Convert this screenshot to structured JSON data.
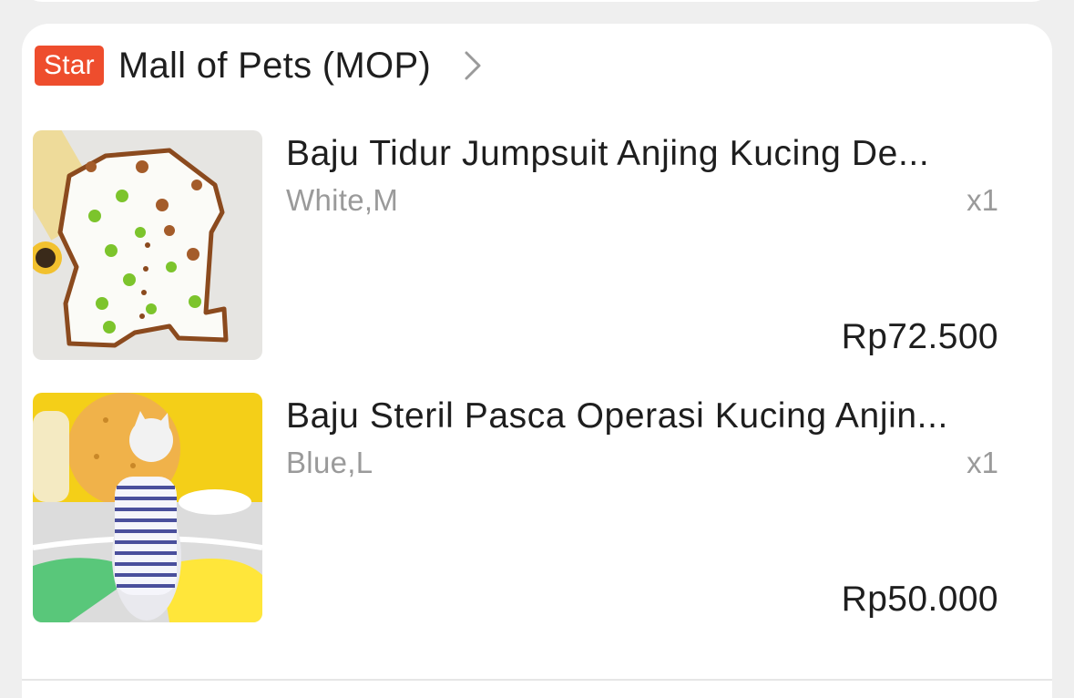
{
  "shop": {
    "badge": "Star",
    "name": "Mall of Pets (MOP)",
    "chevron_icon": "chevron-right-icon"
  },
  "items": [
    {
      "title": "Baju Tidur Jumpsuit Anjing Kucing De...",
      "variant": "White,M",
      "quantity": "x1",
      "price": "Rp72.500",
      "image_icon": "pet-jumpsuit-white-image"
    },
    {
      "title": "Baju Steril Pasca Operasi Kucing Anjin...",
      "variant": "Blue,L",
      "quantity": "x1",
      "price": "Rp50.000",
      "image_icon": "cat-striped-shirt-image"
    }
  ],
  "colors": {
    "badge_bg": "#ee4d2d",
    "text_primary": "#1e1e1e",
    "text_secondary": "#9a9a9a",
    "page_bg": "#efefef",
    "card_bg": "#ffffff"
  }
}
